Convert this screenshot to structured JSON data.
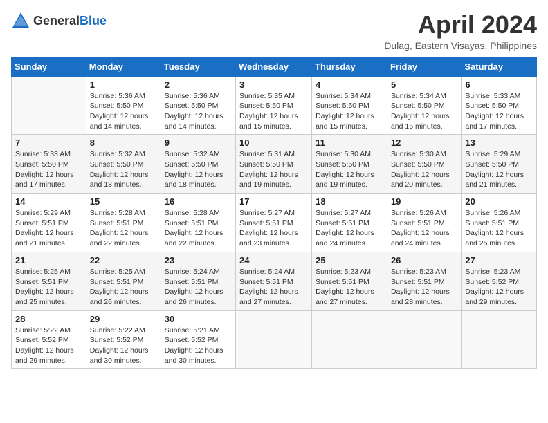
{
  "header": {
    "logo_general": "General",
    "logo_blue": "Blue",
    "month_year": "April 2024",
    "location": "Dulag, Eastern Visayas, Philippines"
  },
  "columns": [
    "Sunday",
    "Monday",
    "Tuesday",
    "Wednesday",
    "Thursday",
    "Friday",
    "Saturday"
  ],
  "weeks": [
    [
      {
        "day": "",
        "info": ""
      },
      {
        "day": "1",
        "info": "Sunrise: 5:36 AM\nSunset: 5:50 PM\nDaylight: 12 hours\nand 14 minutes."
      },
      {
        "day": "2",
        "info": "Sunrise: 5:36 AM\nSunset: 5:50 PM\nDaylight: 12 hours\nand 14 minutes."
      },
      {
        "day": "3",
        "info": "Sunrise: 5:35 AM\nSunset: 5:50 PM\nDaylight: 12 hours\nand 15 minutes."
      },
      {
        "day": "4",
        "info": "Sunrise: 5:34 AM\nSunset: 5:50 PM\nDaylight: 12 hours\nand 15 minutes."
      },
      {
        "day": "5",
        "info": "Sunrise: 5:34 AM\nSunset: 5:50 PM\nDaylight: 12 hours\nand 16 minutes."
      },
      {
        "day": "6",
        "info": "Sunrise: 5:33 AM\nSunset: 5:50 PM\nDaylight: 12 hours\nand 17 minutes."
      }
    ],
    [
      {
        "day": "7",
        "info": "Sunrise: 5:33 AM\nSunset: 5:50 PM\nDaylight: 12 hours\nand 17 minutes."
      },
      {
        "day": "8",
        "info": "Sunrise: 5:32 AM\nSunset: 5:50 PM\nDaylight: 12 hours\nand 18 minutes."
      },
      {
        "day": "9",
        "info": "Sunrise: 5:32 AM\nSunset: 5:50 PM\nDaylight: 12 hours\nand 18 minutes."
      },
      {
        "day": "10",
        "info": "Sunrise: 5:31 AM\nSunset: 5:50 PM\nDaylight: 12 hours\nand 19 minutes."
      },
      {
        "day": "11",
        "info": "Sunrise: 5:30 AM\nSunset: 5:50 PM\nDaylight: 12 hours\nand 19 minutes."
      },
      {
        "day": "12",
        "info": "Sunrise: 5:30 AM\nSunset: 5:50 PM\nDaylight: 12 hours\nand 20 minutes."
      },
      {
        "day": "13",
        "info": "Sunrise: 5:29 AM\nSunset: 5:50 PM\nDaylight: 12 hours\nand 21 minutes."
      }
    ],
    [
      {
        "day": "14",
        "info": "Sunrise: 5:29 AM\nSunset: 5:51 PM\nDaylight: 12 hours\nand 21 minutes."
      },
      {
        "day": "15",
        "info": "Sunrise: 5:28 AM\nSunset: 5:51 PM\nDaylight: 12 hours\nand 22 minutes."
      },
      {
        "day": "16",
        "info": "Sunrise: 5:28 AM\nSunset: 5:51 PM\nDaylight: 12 hours\nand 22 minutes."
      },
      {
        "day": "17",
        "info": "Sunrise: 5:27 AM\nSunset: 5:51 PM\nDaylight: 12 hours\nand 23 minutes."
      },
      {
        "day": "18",
        "info": "Sunrise: 5:27 AM\nSunset: 5:51 PM\nDaylight: 12 hours\nand 24 minutes."
      },
      {
        "day": "19",
        "info": "Sunrise: 5:26 AM\nSunset: 5:51 PM\nDaylight: 12 hours\nand 24 minutes."
      },
      {
        "day": "20",
        "info": "Sunrise: 5:26 AM\nSunset: 5:51 PM\nDaylight: 12 hours\nand 25 minutes."
      }
    ],
    [
      {
        "day": "21",
        "info": "Sunrise: 5:25 AM\nSunset: 5:51 PM\nDaylight: 12 hours\nand 25 minutes."
      },
      {
        "day": "22",
        "info": "Sunrise: 5:25 AM\nSunset: 5:51 PM\nDaylight: 12 hours\nand 26 minutes."
      },
      {
        "day": "23",
        "info": "Sunrise: 5:24 AM\nSunset: 5:51 PM\nDaylight: 12 hours\nand 26 minutes."
      },
      {
        "day": "24",
        "info": "Sunrise: 5:24 AM\nSunset: 5:51 PM\nDaylight: 12 hours\nand 27 minutes."
      },
      {
        "day": "25",
        "info": "Sunrise: 5:23 AM\nSunset: 5:51 PM\nDaylight: 12 hours\nand 27 minutes."
      },
      {
        "day": "26",
        "info": "Sunrise: 5:23 AM\nSunset: 5:51 PM\nDaylight: 12 hours\nand 28 minutes."
      },
      {
        "day": "27",
        "info": "Sunrise: 5:23 AM\nSunset: 5:52 PM\nDaylight: 12 hours\nand 29 minutes."
      }
    ],
    [
      {
        "day": "28",
        "info": "Sunrise: 5:22 AM\nSunset: 5:52 PM\nDaylight: 12 hours\nand 29 minutes."
      },
      {
        "day": "29",
        "info": "Sunrise: 5:22 AM\nSunset: 5:52 PM\nDaylight: 12 hours\nand 30 minutes."
      },
      {
        "day": "30",
        "info": "Sunrise: 5:21 AM\nSunset: 5:52 PM\nDaylight: 12 hours\nand 30 minutes."
      },
      {
        "day": "",
        "info": ""
      },
      {
        "day": "",
        "info": ""
      },
      {
        "day": "",
        "info": ""
      },
      {
        "day": "",
        "info": ""
      }
    ]
  ]
}
